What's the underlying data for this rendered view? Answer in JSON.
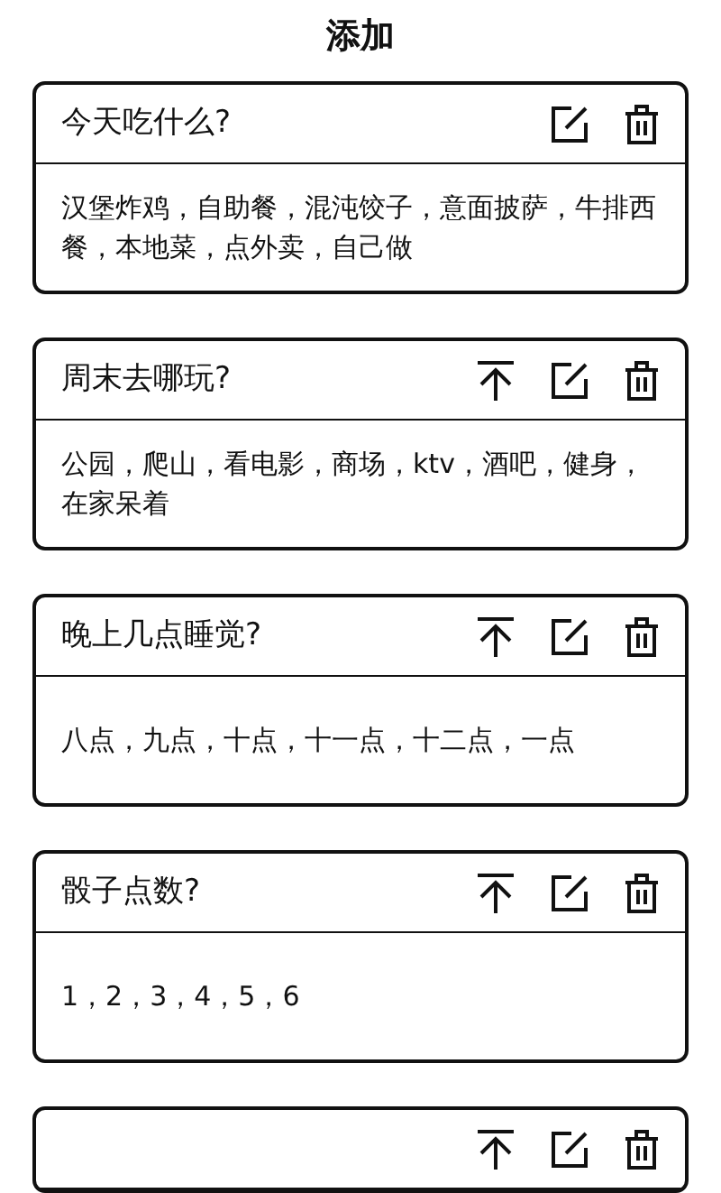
{
  "header": {
    "title": "添加"
  },
  "cards": [
    {
      "title": "今天吃什么?",
      "top_button": false,
      "options": "汉堡炸鸡，自助餐，混沌饺子，意面披萨，牛排西餐，本地菜，点外卖，自己做"
    },
    {
      "title": "周末去哪玩?",
      "top_button": true,
      "options": "公园，爬山，看电影，商场，ktv，酒吧，健身，在家呆着"
    },
    {
      "title": "晚上几点睡觉?",
      "top_button": true,
      "options": "八点，九点，十点，十一点，十二点，一点"
    },
    {
      "title": "骰子点数?",
      "top_button": true,
      "options": "1，2，3，4，5，6"
    },
    {
      "top_button": true
    }
  ]
}
